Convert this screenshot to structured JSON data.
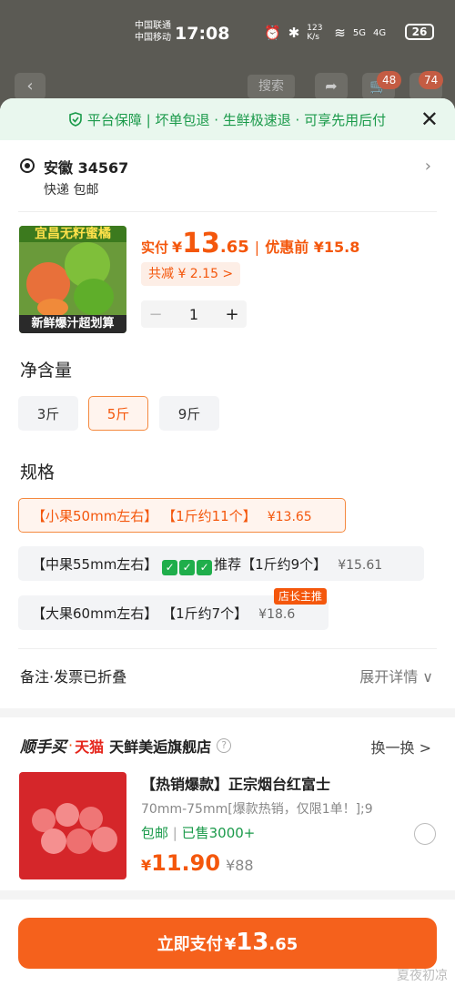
{
  "status_bar": {
    "carrier1": "中国联通",
    "carrier2": "中国移动",
    "time": "17:08",
    "net_speed": "123 K/s",
    "net_labels": [
      "5G",
      "4G"
    ],
    "battery": "26"
  },
  "background": {
    "search_label": "搜索",
    "cart_badge": "48",
    "more_badge": "74"
  },
  "guarantee": {
    "text": "平台保障 | 坏单包退 · 生鲜极速退 · 可享先用后付"
  },
  "address": {
    "main": "安徽 34567",
    "delivery": "快递 包邮"
  },
  "product": {
    "image_top_text": "宜昌无籽蜜橘",
    "image_bottom_text": "新鲜爆汁超划算",
    "pay_label": "实付",
    "currency": "¥",
    "price_int": "13",
    "price_dec": ".65",
    "before_label": "优惠前 ¥15.8",
    "saving": "共减 ¥ 2.15 >",
    "quantity": "1",
    "minus": "−",
    "plus": "+"
  },
  "net_content": {
    "title": "净含量",
    "options": [
      {
        "label": "3斤",
        "selected": false
      },
      {
        "label": "5斤",
        "selected": true
      },
      {
        "label": "9斤",
        "selected": false
      }
    ]
  },
  "spec": {
    "title": "规格",
    "options": [
      {
        "label": "【小果50mm左右】 【1斤约11个】",
        "price": "¥13.65",
        "selected": true
      },
      {
        "label_pre": "【中果55mm左右】 ",
        "checks": "✓",
        "label_post": "推荐【1斤约9个】",
        "price": "¥15.61",
        "selected": false
      },
      {
        "label": "【大果60mm左右】 【1斤约7个】",
        "price": "¥18.6",
        "selected": false,
        "tag": "店长主推"
      }
    ]
  },
  "remark": {
    "label": "备注·发票已折叠",
    "expand": "展开详情 ∨"
  },
  "recommend": {
    "brand": "顺手买",
    "dot": "·",
    "platform": "天猫",
    "store": "天鲜美逅旗舰店",
    "help": "?",
    "swap": "换一换 >",
    "title": "【热销爆款】正宗烟台红富士",
    "desc": "70mm-75mm[爆款热销，仅限1单！];9",
    "ship": "包邮",
    "sold": "已售3000+",
    "currency": "¥",
    "price": "11.90",
    "orig": "¥88"
  },
  "pay": {
    "label": "立即支付",
    "currency": "¥",
    "int": "13",
    "dec": ".65"
  },
  "watermark": "夏夜初凉"
}
